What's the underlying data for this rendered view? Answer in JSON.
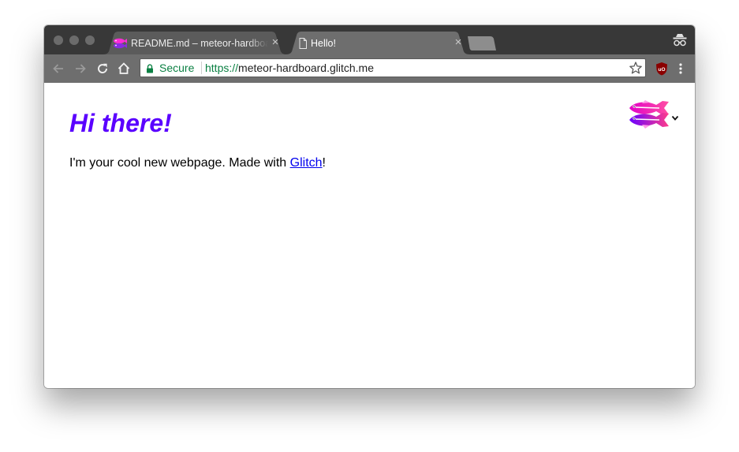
{
  "browser": {
    "tabs": [
      {
        "title": "README.md – meteor-hardboard",
        "active": false,
        "favicon": "glitch-fish-icon"
      },
      {
        "title": "Hello!",
        "active": true,
        "favicon": "document-icon"
      }
    ],
    "omnibox": {
      "security_label": "Secure",
      "url_scheme": "https://",
      "url_host": "meteor-hardboard.glitch.me"
    },
    "icons": {
      "back": "arrow-left-icon",
      "forward": "arrow-right-icon",
      "reload": "reload-icon",
      "home": "home-icon",
      "bookmark": "star-icon",
      "extension": "ublock-icon",
      "menu": "kebab-menu-icon",
      "incognito": "incognito-icon"
    },
    "colors": {
      "tabstrip": "#383838",
      "toolbar": "#6e6e6e",
      "secure_green": "#0b8043"
    }
  },
  "page": {
    "heading": "Hi there!",
    "text_before_link": "I'm your cool new webpage. Made with ",
    "link_text": "Glitch",
    "text_after_link": "!",
    "colors": {
      "heading": "#5a00ff",
      "link": "#0000ee"
    }
  }
}
